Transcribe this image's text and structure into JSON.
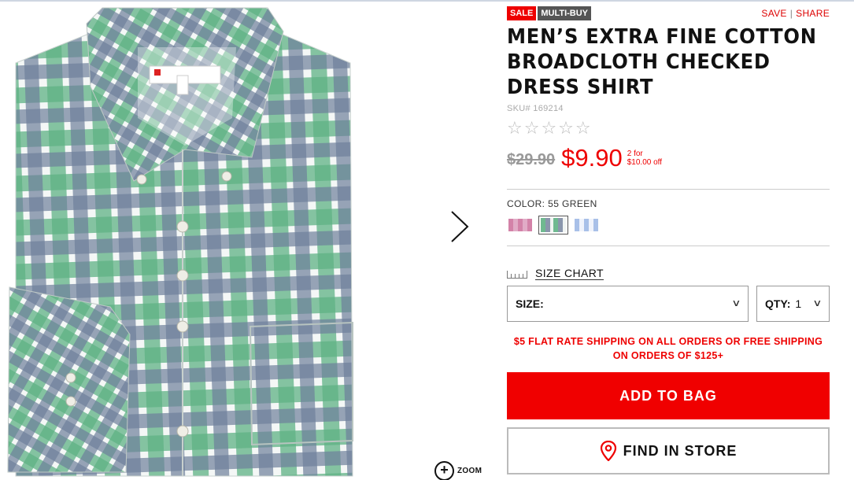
{
  "badges": {
    "sale": "SALE",
    "multi": "MULTI-BUY"
  },
  "actions": {
    "save": "SAVE",
    "sep": "|",
    "share": "SHARE"
  },
  "product": {
    "title": "MEN’S EXTRA FINE COTTON BROADCLOTH CHECKED DRESS SHIRT",
    "sku": "SKU# 169214",
    "rating_stars": "☆☆☆☆☆",
    "old_price": "$29.90",
    "price": "$9.90",
    "promo_line1": "2 for",
    "promo_line2": "$10.00 off"
  },
  "color": {
    "label": "COLOR: 55 GREEN",
    "swatches": [
      {
        "name": "pink-check",
        "color": "#e4a7c6"
      },
      {
        "name": "green-check",
        "color": "#6faf8a",
        "selected": true
      },
      {
        "name": "blue-check",
        "color": "#9fb9e6"
      }
    ]
  },
  "size_chart": {
    "label": "SIZE CHART"
  },
  "selects": {
    "size_label": "SIZE:",
    "size_value": "",
    "qty_label": "QTY:",
    "qty_value": "1",
    "chevron": "∨"
  },
  "shipping": {
    "line1": "$5 FLAT RATE SHIPPING ON ALL ORDERS OR FREE SHIPPING",
    "line2": "ON ORDERS OF $125+"
  },
  "buttons": {
    "add_to_bag": "ADD TO BAG",
    "find_in_store": "FIND IN STORE"
  },
  "zoom": {
    "label": "ZOOM",
    "icon": "+"
  },
  "colors": {
    "accent": "#e00000",
    "sale_badge": "#e00000",
    "multi_badge": "#555555"
  },
  "icons": [
    "chevron-right-icon",
    "zoom-icon",
    "ruler-icon",
    "location-pin-icon",
    "star-icon"
  ]
}
